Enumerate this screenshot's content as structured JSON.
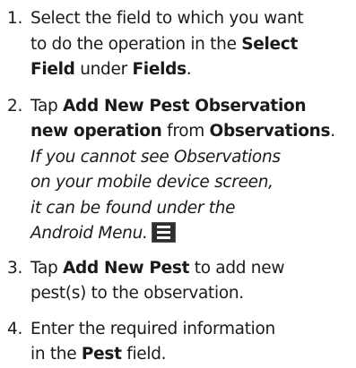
{
  "steps": [
    {
      "number": "1.",
      "t1": "Select the field to which you want",
      "t2": "to do the operation in the ",
      "b1": "Select",
      "b2": "Field",
      "t3": " under ",
      "b3": "Fields",
      "t4": "."
    },
    {
      "number": "2.",
      "t1": "Tap ",
      "b1": "Add New Pest Observation",
      "b2": "new operation",
      "t2": " from ",
      "b3": "Observations",
      "t3": ".",
      "note": [
        "If you cannot see Observations",
        "on your mobile device screen,",
        "it can be found under the",
        "Android Menu."
      ]
    },
    {
      "number": "3.",
      "t1": "Tap ",
      "b1": "Add New Pest",
      "t2": " to add new",
      "t3": "pest(s) to the observation."
    },
    {
      "number": "4.",
      "t1": "Enter the required information",
      "t2": "in the ",
      "b1": "Pest",
      "t3": " field."
    }
  ],
  "icons": {
    "android_menu": "menu-icon"
  }
}
